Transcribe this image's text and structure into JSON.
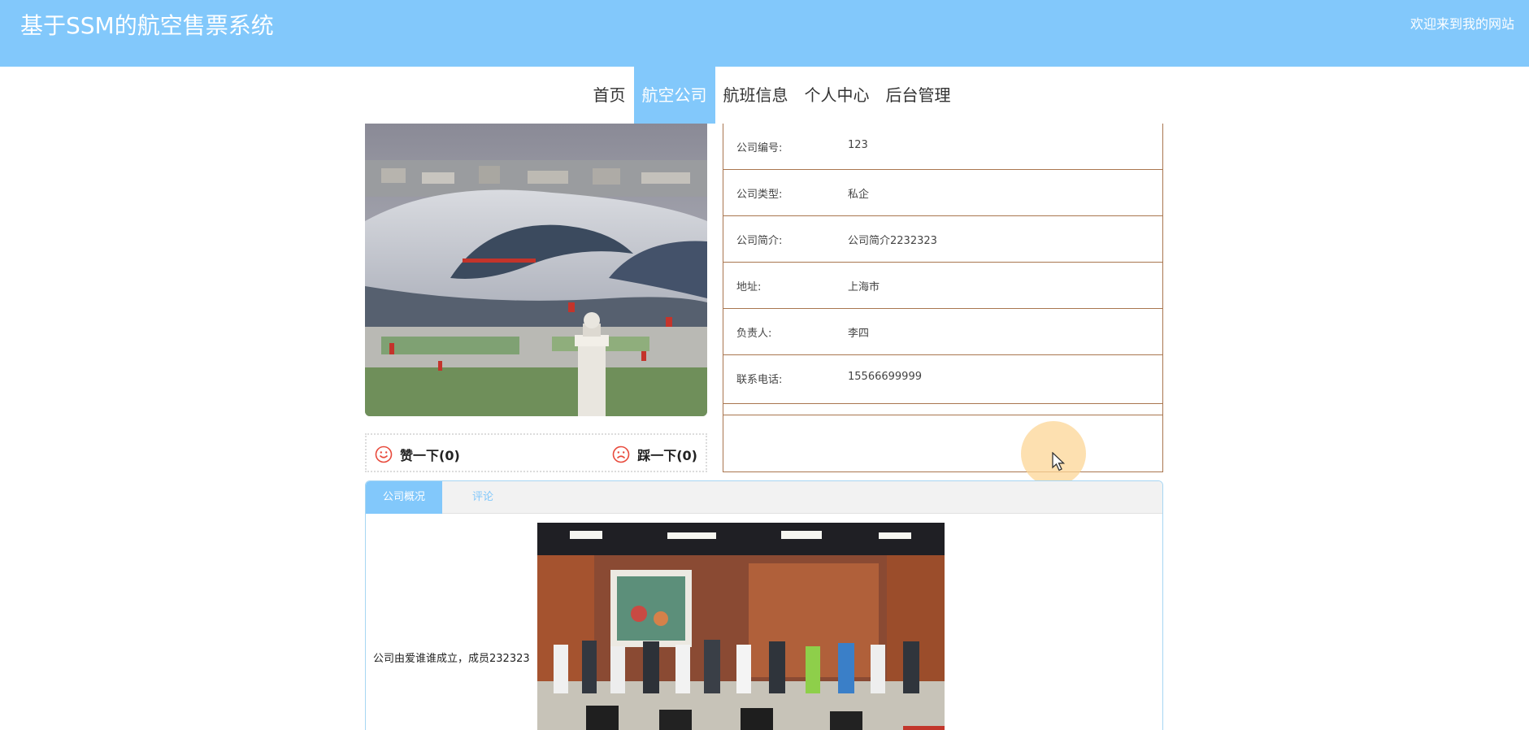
{
  "header": {
    "site_title": "基于SSM的航空售票系统",
    "welcome": "欢迎来到我的网站"
  },
  "nav": {
    "items": [
      "首页",
      "航空公司",
      "航班信息",
      "个人中心",
      "后台管理"
    ],
    "active_index": 1
  },
  "votes": {
    "like_label": "赞一下(0)",
    "dislike_label": "踩一下(0)"
  },
  "company": {
    "rows": [
      {
        "label": "公司编号:",
        "value": "123"
      },
      {
        "label": "公司类型:",
        "value": "私企"
      },
      {
        "label": "公司简介:",
        "value": "公司简介2232323"
      },
      {
        "label": "地址:",
        "value": "上海市"
      },
      {
        "label": "负责人:",
        "value": "李四"
      },
      {
        "label": "联系电话:",
        "value": "15566699999"
      }
    ]
  },
  "tabs": {
    "overview_label": "公司概况",
    "comments_label": "评论",
    "overview_text": "公司由爱谁谁成立，成员232323"
  },
  "colors": {
    "brand": "#82c8fb",
    "table_border": "#a9764f",
    "vote_icon": "#e84a3c"
  },
  "icons": {
    "like": "smile-face-icon",
    "dislike": "frown-face-icon",
    "cursor": "mouse-pointer-icon"
  }
}
